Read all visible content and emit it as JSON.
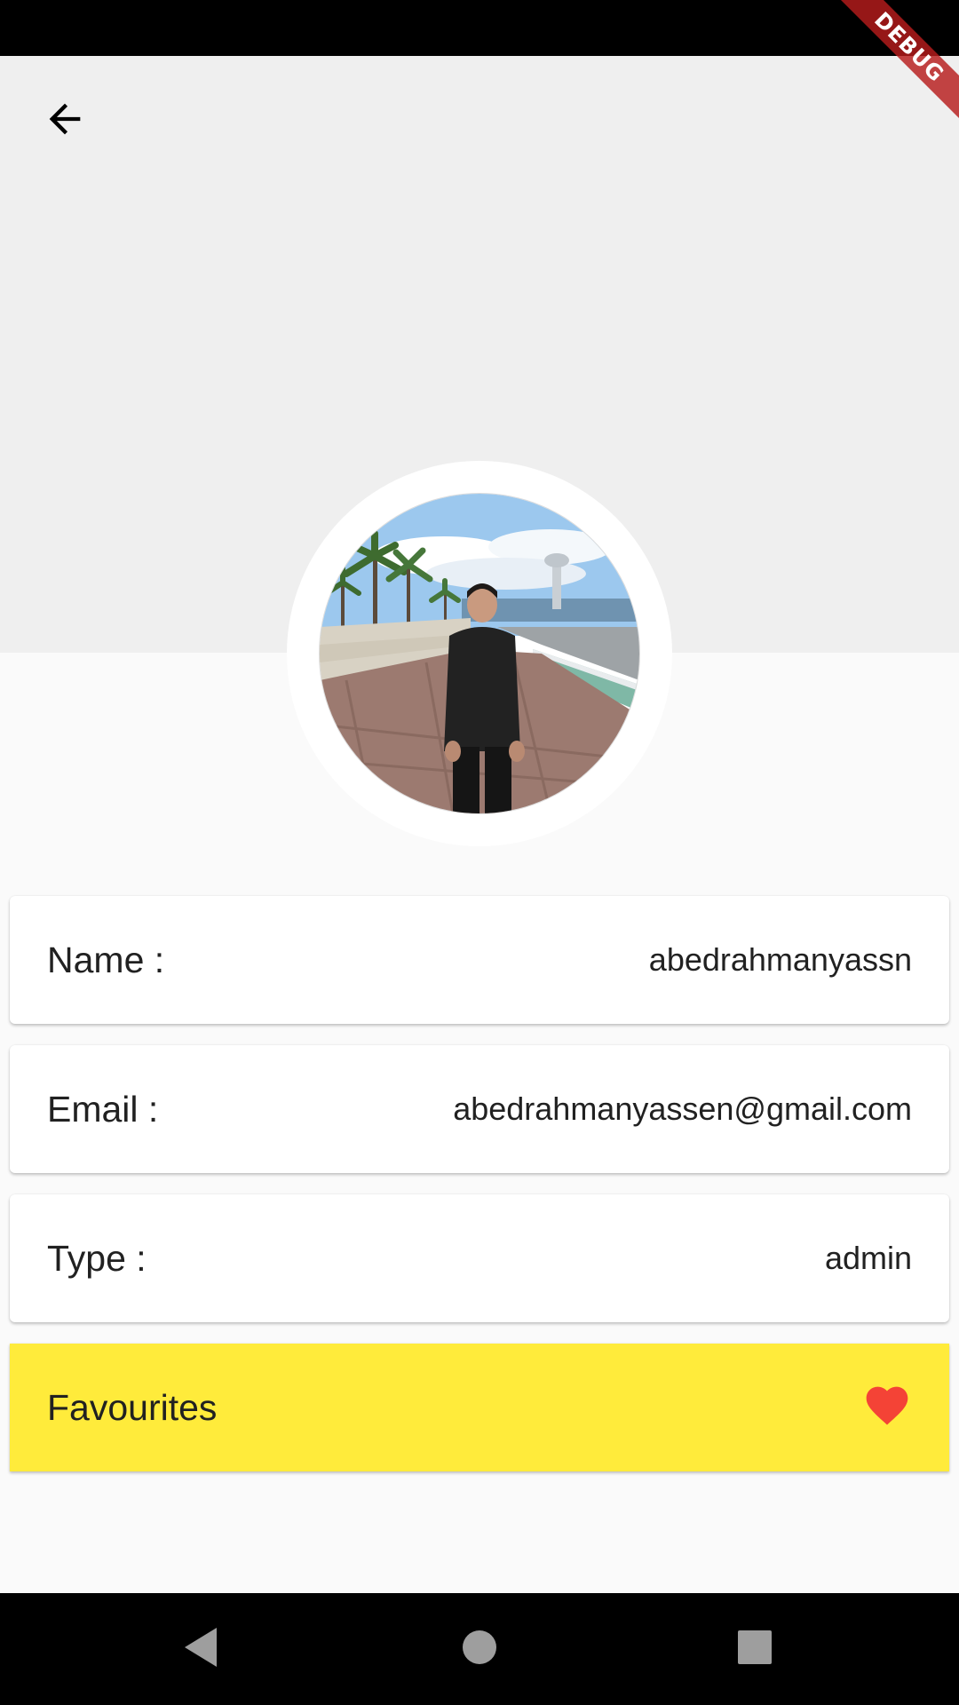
{
  "profile": {
    "rows": [
      {
        "label": "Name :",
        "value": "abedrahmanyassn"
      },
      {
        "label": "Email :",
        "value": "abedrahmanyassen@gmail.com"
      },
      {
        "label": "Type :",
        "value": "admin"
      }
    ],
    "favourites_label": "Favourites"
  },
  "debug_banner": "DEBUG",
  "icons": {
    "back": "arrow-back-icon",
    "favourite": "heart-icon",
    "nav_back": "triangle-back-icon",
    "nav_home": "circle-home-icon",
    "nav_recents": "square-recents-icon"
  },
  "colors": {
    "header_background": "#efefef",
    "page_background": "#fafafa",
    "favourites_background": "#ffeb3b",
    "heart": "#f44336",
    "debug_ribbon": "#b71c1c"
  }
}
